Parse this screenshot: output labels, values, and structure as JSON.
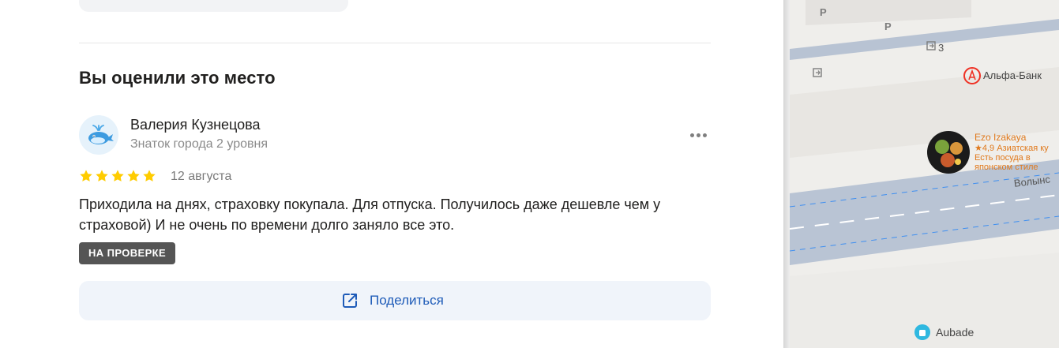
{
  "section": {
    "title": "Вы оценили это место"
  },
  "review": {
    "author": {
      "name": "Валерия Кузнецова",
      "level": "Знаток города 2 уровня"
    },
    "rating": 5,
    "date": "12 августа",
    "text": "Приходила на днях, страховку покупала. Для отпуска. Получилось даже дешевле чем у страховой) И не очень по времени долго заняло все это.",
    "status_badge": "НА ПРОВЕРКЕ"
  },
  "share": {
    "label": "Поделиться"
  },
  "map": {
    "labels": {
      "parking": "P",
      "entrance_number": "3",
      "alfa_bank": "Альфа-Банк",
      "ezo_name": "Ezo Izakaya",
      "ezo_rating_line": "★4,9 Азиатская ку",
      "ezo_desc_line1": "Есть посуда в",
      "ezo_desc_line2": "японском стиле",
      "street": "Волынс",
      "aubade": "Aubade"
    }
  },
  "colors": {
    "accent": "#1e5bb8",
    "star": "#fc0",
    "badge_bg": "#555555",
    "alfa_red": "#ef3124",
    "poi_orange": "#e0791c"
  },
  "icons": {
    "more": "more-dots-icon",
    "share": "share-external-icon",
    "avatar": "whale-icon"
  }
}
